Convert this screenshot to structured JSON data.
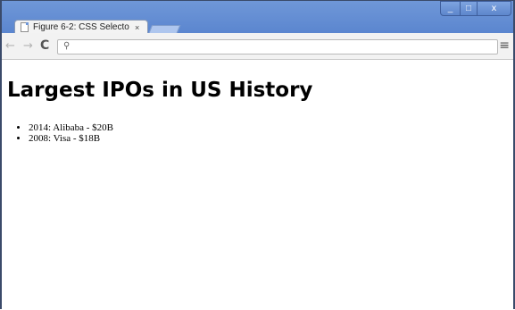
{
  "browser": {
    "tab_title": "Figure 6-2: CSS Selecto",
    "tab_close": "×",
    "controls": {
      "minimize": "_",
      "maximize": "□",
      "close": "x"
    }
  },
  "toolbar": {
    "back": "←",
    "forward": "→",
    "reload": "C",
    "search_icon": "⚲",
    "address": "",
    "menu": "≡"
  },
  "page": {
    "heading": "Largest IPOs in US History",
    "items": [
      "2014: Alibaba - $20B",
      "2008: Visa - $18B"
    ]
  },
  "colors": {
    "titlebar": "#6f97d8",
    "toolbar": "#f2f2f2",
    "page": "#ffffff"
  }
}
